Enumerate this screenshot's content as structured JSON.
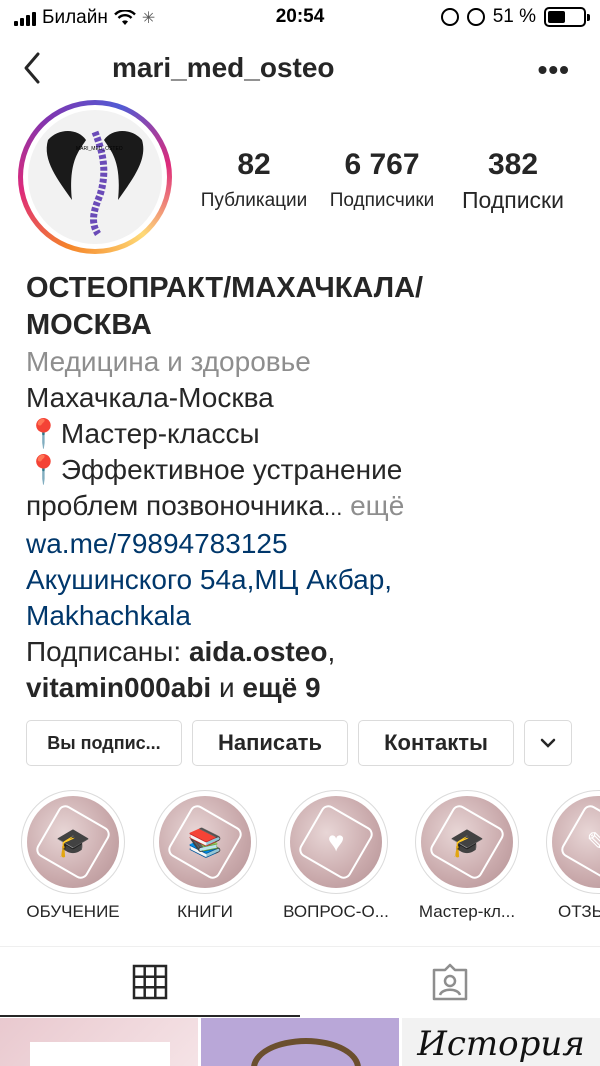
{
  "status_bar": {
    "carrier": "Билайн",
    "time": "20:54",
    "battery_percent": "51 %",
    "battery_level": 0.51
  },
  "nav": {
    "username": "mari_med_osteo",
    "more": "•••"
  },
  "avatar": {
    "logo_text": "MARI_MED_OSTEO"
  },
  "stats": [
    {
      "value": "82",
      "label": "Публикации"
    },
    {
      "value": "6 767",
      "label": "Подписчики"
    },
    {
      "value": "382",
      "label": "Подписки"
    }
  ],
  "bio": {
    "name_line1": "ОСТЕОПРАКТ/МАХАЧКАЛА/",
    "name_line2": "МОСКВА",
    "category": "Медицина и здоровье",
    "line1": "Махачкала-Москва",
    "line2": "📍Мастер-классы",
    "line3": "📍Эффективное устранение",
    "line4": "проблем позвоночника",
    "ellipsis": "...",
    "more": "ещё",
    "link": "wa.me/79894783125",
    "address1": "Акушинского 54а,МЦ Акбар,",
    "address2": "Makhachkala",
    "followed_prefix": "Подписаны: ",
    "followed_user1": "aida.osteo",
    "followed_comma": ",",
    "followed_user2": "vitamin000abi",
    "followed_and": " и ",
    "followed_more": "ещё 9"
  },
  "buttons": {
    "subscribed": "Вы подпис...",
    "message": "Написать",
    "contacts": "Контакты"
  },
  "highlights": [
    {
      "label": "ОБУЧЕНИЕ",
      "icon": "graduate-icon",
      "glyph": "🎓"
    },
    {
      "label": "КНИГИ",
      "icon": "books-icon",
      "glyph": "📚"
    },
    {
      "label": "ВОПРОС-О...",
      "icon": "heart-icon",
      "glyph": "♥"
    },
    {
      "label": "Мастер-кл...",
      "icon": "mortarboard-icon",
      "glyph": "🎓"
    },
    {
      "label": "ОТЗЫ",
      "icon": "pencil-icon",
      "glyph": "✎"
    }
  ],
  "posts": {
    "post3_text": "История"
  }
}
